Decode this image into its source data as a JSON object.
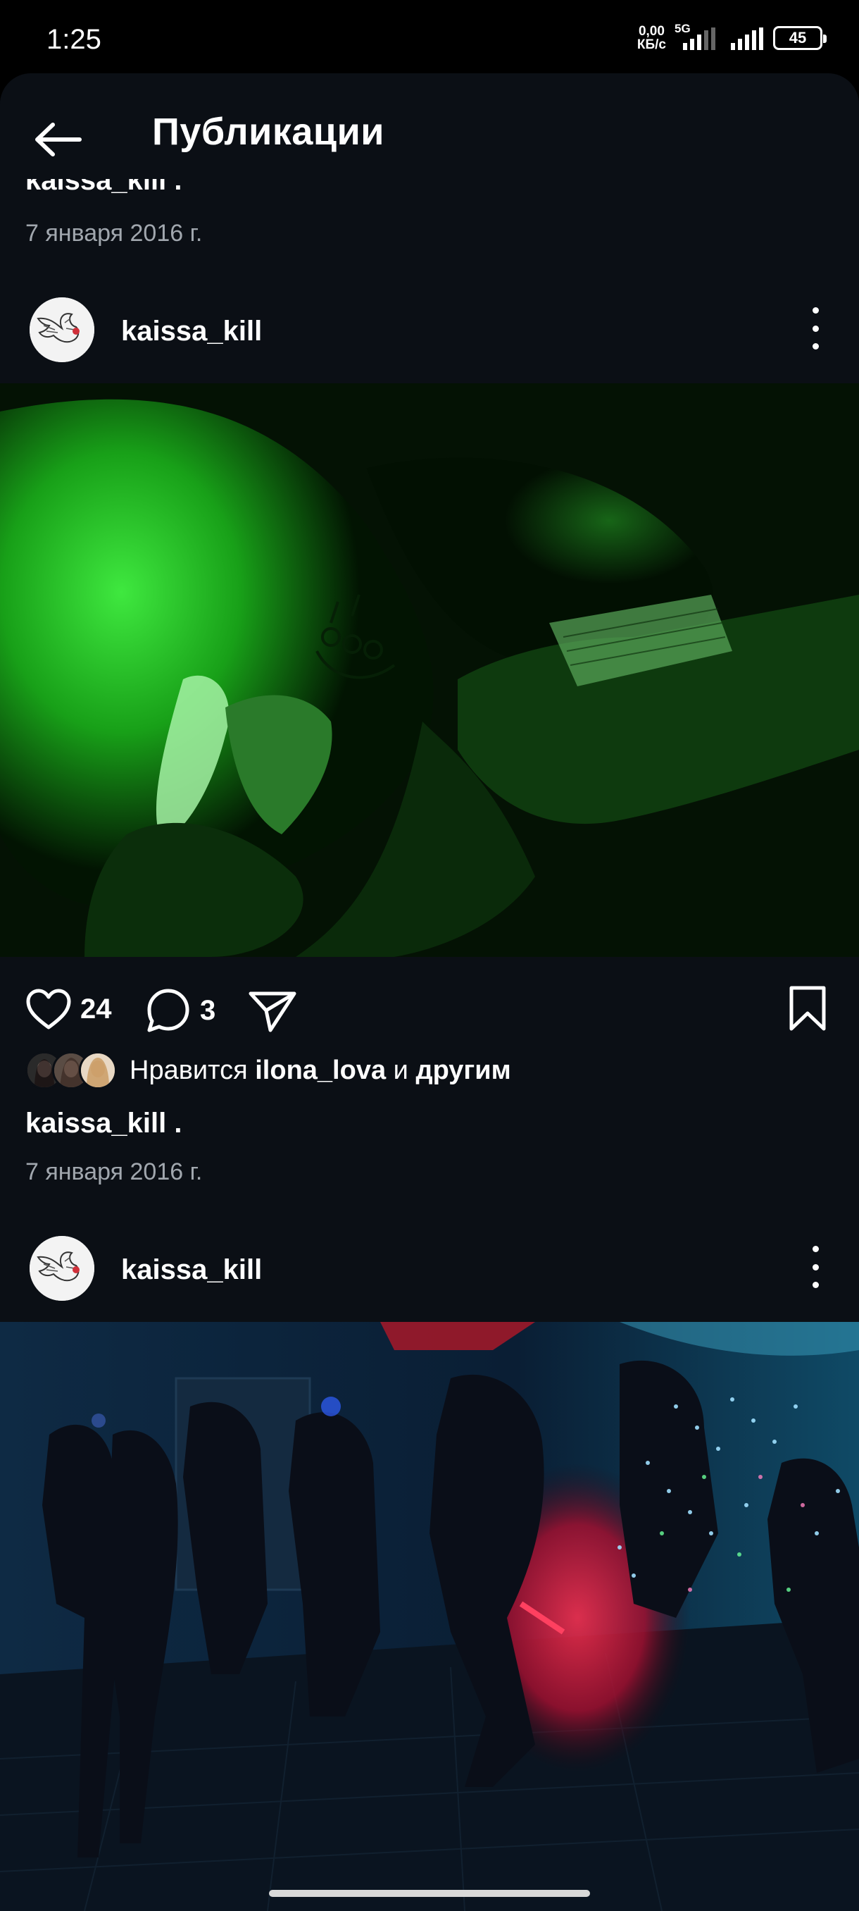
{
  "status": {
    "time": "1:25",
    "net_speed_value": "0,00",
    "net_speed_unit": "КБ/с",
    "network_type": "5G",
    "battery": "45"
  },
  "header": {
    "title": "Публикации"
  },
  "prev_post": {
    "caption_user": "kaissa_kill",
    "caption_text": ".",
    "date": "7 января 2016 г."
  },
  "post1": {
    "username": "kaissa_kill",
    "likes_count": "24",
    "comments_count": "3",
    "liked_prefix": "Нравится",
    "liked_user": "ilona_lova",
    "liked_and": "и",
    "liked_others": "другим",
    "caption_user": "kaissa_kill",
    "caption_text": ".",
    "date": "7 января 2016 г."
  },
  "post2": {
    "username": "kaissa_kill"
  },
  "icons": {
    "back": "arrow-left-icon",
    "more": "more-vertical-icon",
    "like": "heart-icon",
    "comment": "comment-bubble-icon",
    "share": "send-icon",
    "save": "bookmark-icon"
  }
}
